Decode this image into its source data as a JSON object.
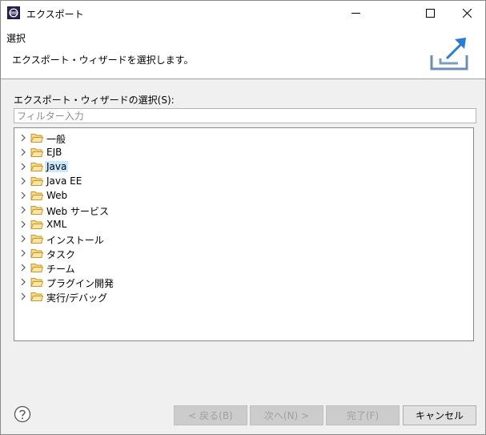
{
  "window": {
    "title": "エクスポート"
  },
  "header": {
    "title": "選択",
    "description": "エクスポート・ウィザードを選択します。"
  },
  "wizard_list": {
    "label": "エクスポート・ウィザードの選択(S):",
    "filter_placeholder": "フィルター入力",
    "items": [
      {
        "label": "一般"
      },
      {
        "label": "EJB"
      },
      {
        "label": "Java"
      },
      {
        "label": "Java EE"
      },
      {
        "label": "Web"
      },
      {
        "label": "Web サービス"
      },
      {
        "label": "XML"
      },
      {
        "label": "インストール"
      },
      {
        "label": "タスク"
      },
      {
        "label": "チーム"
      },
      {
        "label": "プラグイン開発"
      },
      {
        "label": "実行/デバッグ"
      }
    ],
    "selected_item": "Java"
  },
  "buttons": {
    "back": "< 戻る(B)",
    "next": "次へ(N) >",
    "finish": "完了(F)",
    "cancel": "キャンセル"
  },
  "colors": {
    "selection": "#cce8ff",
    "folder": "#e8b84a",
    "accent_icon": "#2b7bd1"
  }
}
